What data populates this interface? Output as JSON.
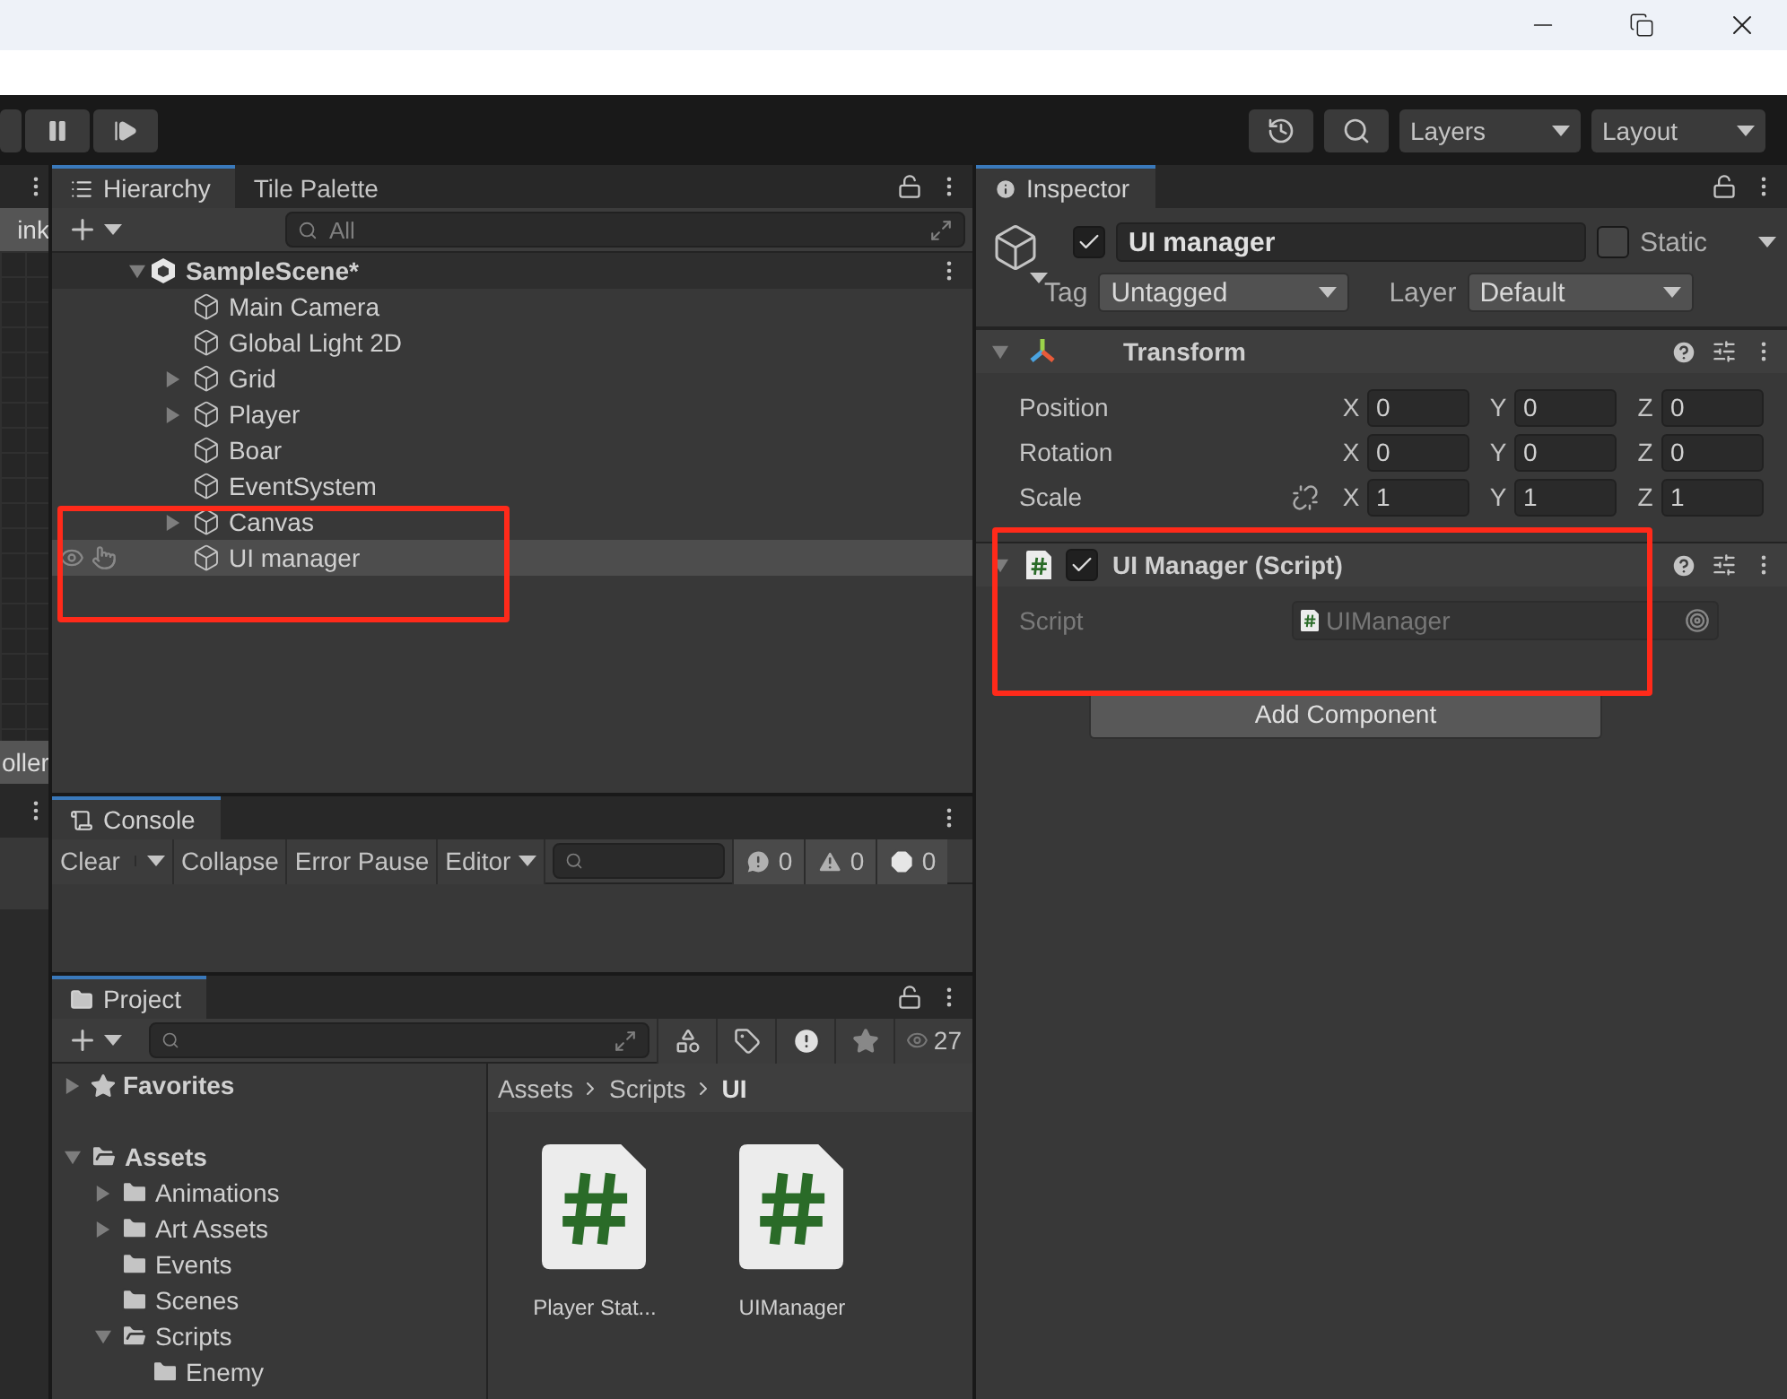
{
  "toolbar": {
    "layers": "Layers",
    "layout": "Layout"
  },
  "left_strip": {
    "top_label": "ink",
    "bottom_label": "oller"
  },
  "hierarchy": {
    "tabs": [
      {
        "label": "Hierarchy",
        "selected": true
      },
      {
        "label": "Tile Palette",
        "selected": false
      }
    ],
    "search_placeholder": "All",
    "scene": {
      "name": "SampleScene*",
      "expanded": true
    },
    "items": [
      {
        "name": "Main Camera",
        "selected": false
      },
      {
        "name": "Global Light 2D",
        "selected": false
      },
      {
        "name": "Grid",
        "expanded": false,
        "selected": false
      },
      {
        "name": "Player",
        "expanded": false,
        "selected": false
      },
      {
        "name": "Boar",
        "selected": false
      },
      {
        "name": "EventSystem",
        "selected": false
      },
      {
        "name": "Canvas",
        "expanded": false,
        "selected": false
      },
      {
        "name": "UI manager",
        "selected": true
      }
    ]
  },
  "console": {
    "tab": "Console",
    "buttons": [
      "Clear",
      "Collapse",
      "Error Pause",
      "Editor"
    ],
    "counts": [
      {
        "kind": "info",
        "count": "0"
      },
      {
        "kind": "warning",
        "count": "0"
      },
      {
        "kind": "error",
        "count": "0"
      }
    ]
  },
  "project": {
    "tab": "Project",
    "count": "27",
    "tree": [
      {
        "name": "Favorites",
        "kind": "favorites",
        "expanded": false
      },
      {
        "name": "Assets",
        "kind": "folder",
        "expanded": true,
        "children": [
          {
            "name": "Animations",
            "kind": "folder",
            "expanded": false
          },
          {
            "name": "Art Assets",
            "kind": "folder",
            "expanded": false
          },
          {
            "name": "Events",
            "kind": "folder"
          },
          {
            "name": "Scenes",
            "kind": "folder"
          },
          {
            "name": "Scripts",
            "kind": "folder",
            "expanded": true,
            "children": [
              {
                "name": "Enemy",
                "kind": "folder"
              }
            ]
          }
        ]
      }
    ],
    "breadcrumb": [
      "Assets",
      "Scripts",
      "UI"
    ],
    "files": [
      "Player Stat...",
      "UIManager"
    ]
  },
  "inspector": {
    "tab": "Inspector",
    "object": {
      "active": true,
      "name": "UI manager",
      "static": false,
      "static_label": "Static",
      "tag_label": "Tag",
      "tag": "Untagged",
      "layer_label": "Layer",
      "layer": "Default"
    },
    "components": [
      {
        "kind": "transform",
        "title": "Transform",
        "expanded": true,
        "rows": [
          {
            "label": "Position",
            "fields": [
              {
                "axis": "X",
                "value": "0"
              },
              {
                "axis": "Y",
                "value": "0"
              },
              {
                "axis": "Z",
                "value": "0"
              }
            ]
          },
          {
            "label": "Rotation",
            "fields": [
              {
                "axis": "X",
                "value": "0"
              },
              {
                "axis": "Y",
                "value": "0"
              },
              {
                "axis": "Z",
                "value": "0"
              }
            ]
          },
          {
            "label": "Scale",
            "linked": false,
            "fields": [
              {
                "axis": "X",
                "value": "1"
              },
              {
                "axis": "Y",
                "value": "1"
              },
              {
                "axis": "Z",
                "value": "1"
              }
            ]
          }
        ]
      },
      {
        "kind": "script",
        "title": "UI Manager (Script)",
        "expanded": true,
        "enabled": true,
        "field_label": "Script",
        "field_value": "UIManager"
      }
    ],
    "add_button": "Add Component"
  }
}
